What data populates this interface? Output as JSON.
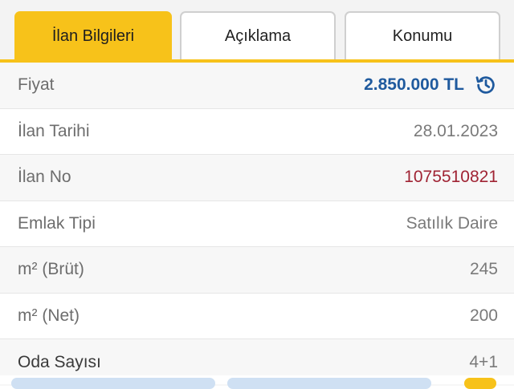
{
  "tabs": [
    {
      "label": "İlan Bilgileri",
      "active": true
    },
    {
      "label": "Açıklama",
      "active": false
    },
    {
      "label": "Konumu",
      "active": false
    }
  ],
  "details": [
    {
      "label": "Fiyat",
      "value": "2.850.000 TL",
      "type": "price"
    },
    {
      "label": "İlan Tarihi",
      "value": "28.01.2023"
    },
    {
      "label": "İlan No",
      "value": "1075510821",
      "type": "listing-no"
    },
    {
      "label": "Emlak Tipi",
      "value": "Satılık Daire"
    },
    {
      "label": "m² (Brüt)",
      "value": "245"
    },
    {
      "label": "m² (Net)",
      "value": "200"
    },
    {
      "label": "Oda Sayısı",
      "value": "4+1"
    }
  ],
  "colors": {
    "accent": "#f7c21a",
    "price": "#1f5a9e",
    "listing_no": "#a02434"
  },
  "icons": {
    "price_history": "history-icon"
  }
}
